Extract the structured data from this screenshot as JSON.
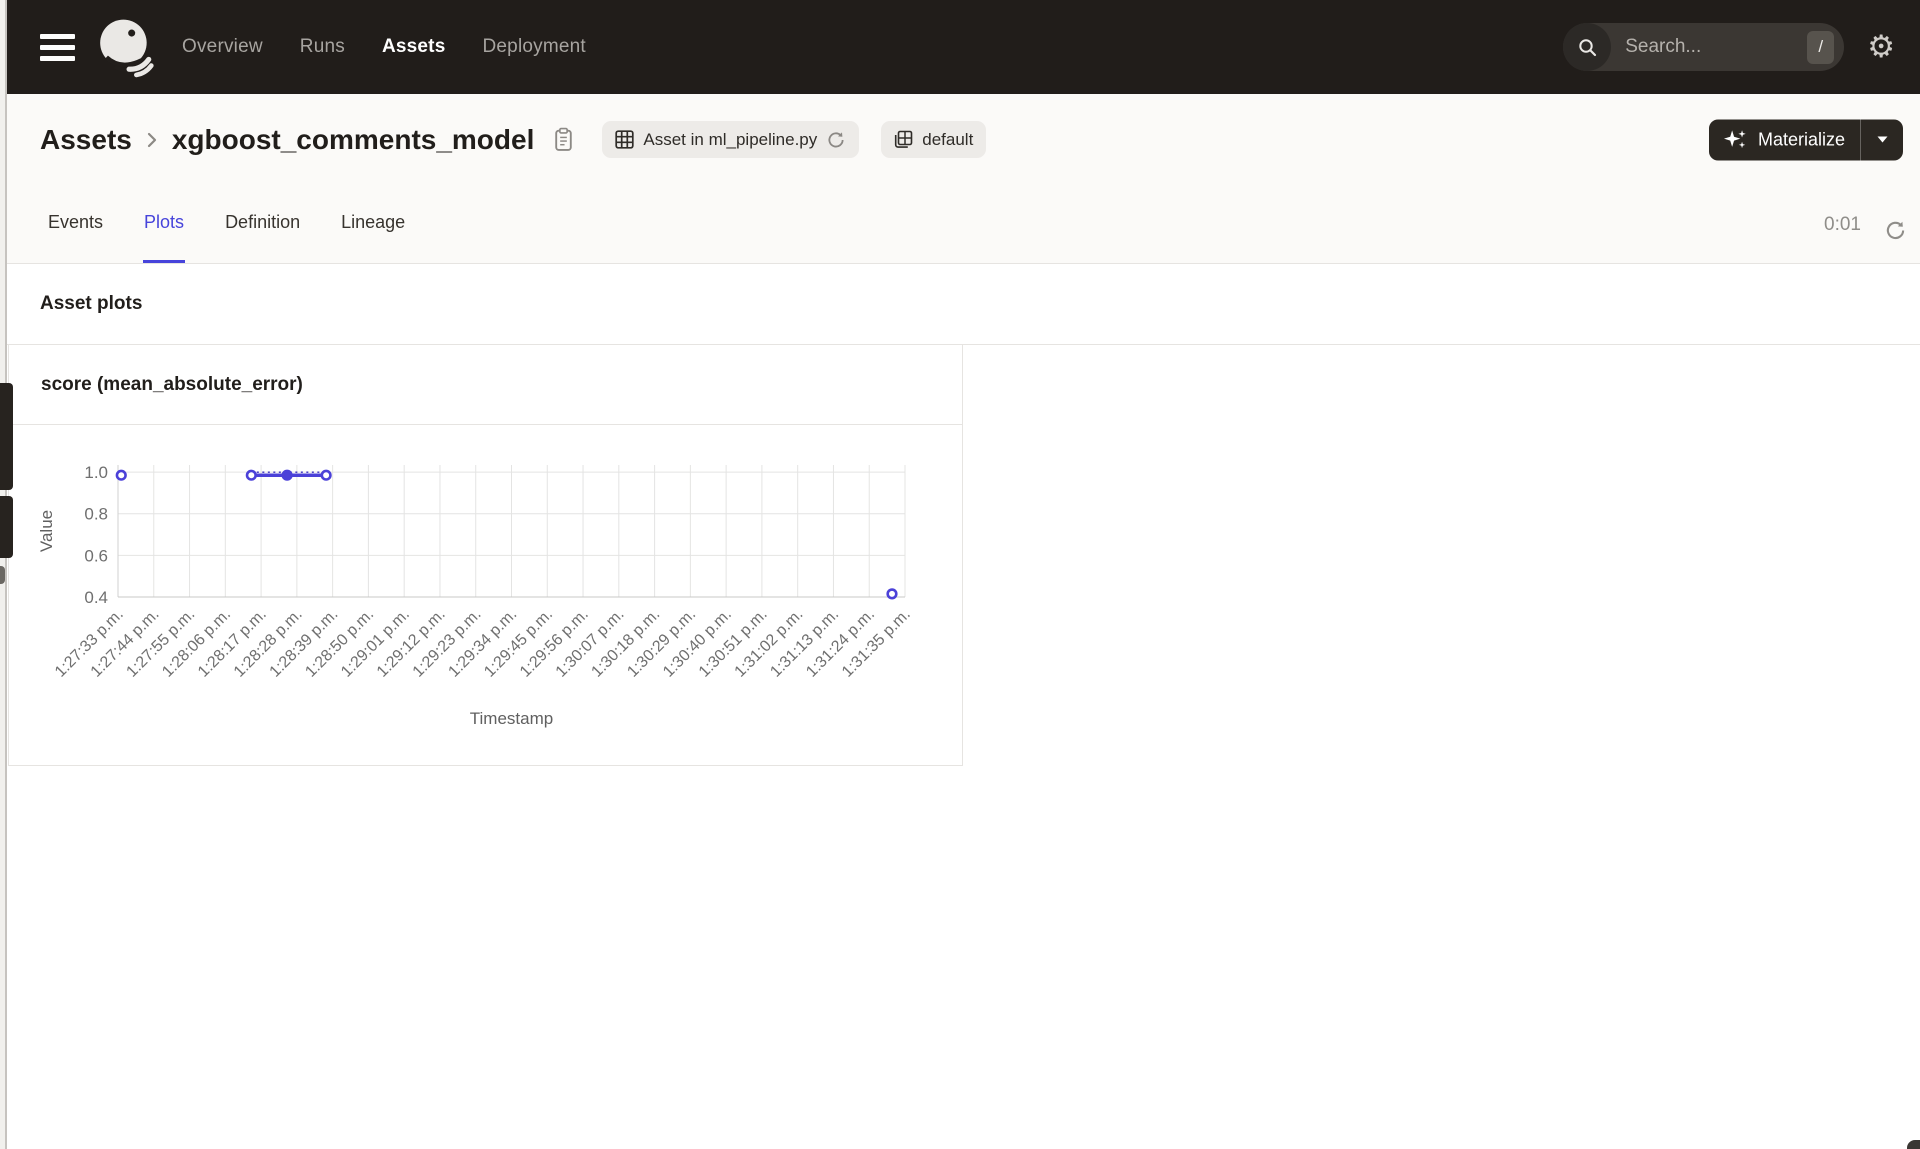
{
  "colors": {
    "nav_bg": "#211D1A",
    "accent": "#4744DB",
    "materialize_bg": "#2B2722"
  },
  "topnav": {
    "items": [
      {
        "label": "Overview",
        "active": false
      },
      {
        "label": "Runs",
        "active": false
      },
      {
        "label": "Assets",
        "active": true
      },
      {
        "label": "Deployment",
        "active": false
      }
    ],
    "search": {
      "placeholder": "Search...",
      "shortcut": "/"
    }
  },
  "header": {
    "breadcrumb": {
      "root": "Assets",
      "current": "xgboost_comments_model"
    },
    "tags": [
      {
        "label": "Asset in ml_pipeline.py",
        "icon": "table-icon",
        "trailing_icon": "reload-icon"
      },
      {
        "label": "default",
        "icon": "asset-group-icon"
      }
    ],
    "materialize_label": "Materialize"
  },
  "tabs": {
    "items": [
      {
        "label": "Events",
        "active": false
      },
      {
        "label": "Plots",
        "active": true
      },
      {
        "label": "Definition",
        "active": false
      },
      {
        "label": "Lineage",
        "active": false
      }
    ],
    "timer": "0:01"
  },
  "section": {
    "title": "Asset plots"
  },
  "plot_card": {
    "title": "score (mean_absolute_error)"
  },
  "icons": {
    "menu": "hamburger-bars",
    "search": "magnifier",
    "settings": "⚙",
    "materialize": "sparkles",
    "dropdown": "caret-down",
    "refresh": "circular-arrow",
    "copy": "clipboard"
  },
  "chart_data": {
    "type": "line",
    "title": "score (mean_absolute_error)",
    "xlabel": "Timestamp",
    "ylabel": "Value",
    "y_ticks": [
      0.4,
      0.6,
      0.8,
      1.0
    ],
    "ylim": [
      0.4,
      1.034
    ],
    "grid": true,
    "legend": "none",
    "series_color": "#4B41D8",
    "dash_color": "#352BBF",
    "x_ticks": [
      "1:27:33 p.m.",
      "1:27:44 p.m.",
      "1:27:55 p.m.",
      "1:28:06 p.m.",
      "1:28:17 p.m.",
      "1:28:28 p.m.",
      "1:28:39 p.m.",
      "1:28:50 p.m.",
      "1:29:01 p.m.",
      "1:29:12 p.m.",
      "1:29:23 p.m.",
      "1:29:34 p.m.",
      "1:29:45 p.m.",
      "1:29:56 p.m.",
      "1:30:07 p.m.",
      "1:30:18 p.m.",
      "1:30:29 p.m.",
      "1:30:40 p.m.",
      "1:30:51 p.m.",
      "1:31:02 p.m.",
      "1:31:13 p.m.",
      "1:31:24 p.m.",
      "1:31:35 p.m."
    ],
    "points": [
      {
        "x": "1:27:34 p.m.",
        "y": 0.985,
        "marker": "ring"
      },
      {
        "x": "1:28:14 p.m.",
        "y": 0.985,
        "marker": "ring"
      },
      {
        "x": "1:28:25 p.m.",
        "y": 0.985,
        "marker": "dot"
      },
      {
        "x": "1:28:37 p.m.",
        "y": 0.985,
        "marker": "ring"
      },
      {
        "x": "1:31:31 p.m.",
        "y": 0.415,
        "marker": "ring"
      }
    ],
    "connected_segment": [
      1,
      2,
      3
    ]
  }
}
